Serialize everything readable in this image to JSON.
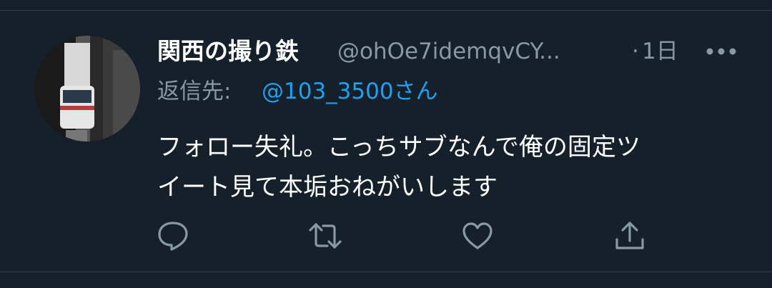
{
  "tweet": {
    "display_name": "関西の撮り鉄",
    "handle": "@ohOe7idemqvCY...",
    "separator": "·",
    "time": "1日",
    "more_label": "•••",
    "reply_prefix": "返信先:",
    "reply_to": "@103_3500さん",
    "text_lines": [
      "フォロー失礼。こっちサブなんで俺の固定ツ",
      "イート見て本垢おねがいします"
    ]
  },
  "actions": {
    "icons": [
      "reply-icon",
      "retweet-icon",
      "like-icon",
      "share-icon"
    ]
  },
  "colors": {
    "background": "#15202b",
    "primary_text": "#ffffff",
    "secondary_text": "#8899a6",
    "link": "#1da1f2",
    "divider": "#38444d"
  }
}
